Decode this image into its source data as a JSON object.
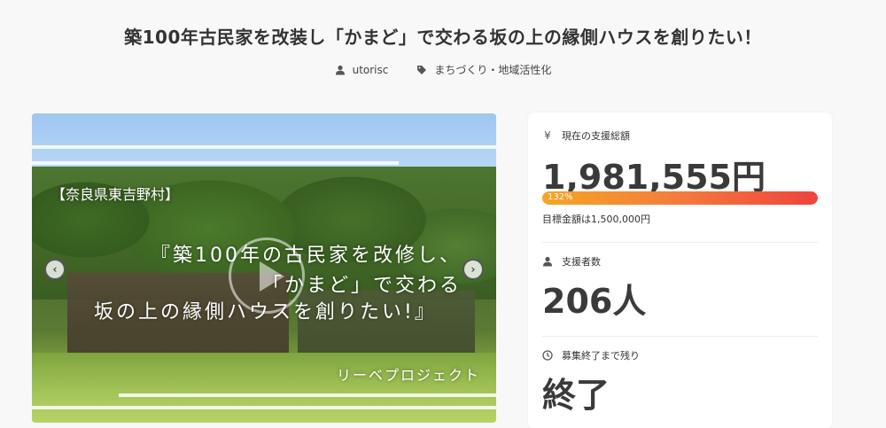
{
  "title": "築100年古民家を改装し「かまど」で交わる坂の上の縁側ハウスを創りたい！",
  "meta": {
    "author": "utorisc",
    "category": "まちづくり・地域活性化"
  },
  "hero": {
    "region": "【奈良県東吉野村】",
    "line1": "『築100年の古民家を改修し、",
    "line2": "「かまど」で交わる",
    "line3": "坂の上の縁側ハウスを創りたい!』",
    "project": "リーベプロジェクト",
    "prev_symbol": "‹",
    "next_symbol": "›"
  },
  "stats": {
    "funding_label": "現在の支援総額",
    "funding_amount": "1,981,555円",
    "progress_label": "132%",
    "progress_fraction": 1.0,
    "goal": "目標金額は1,500,000円",
    "supporters_label": "支援者数",
    "supporters_value": "206人",
    "remaining_label": "募集終了まで残り",
    "remaining_value": "終了"
  },
  "icons": {
    "author": "user-icon",
    "category": "tag-icon",
    "funding": "yen-icon",
    "supporters": "user-icon",
    "remaining": "clock-icon"
  },
  "colors": {
    "progress_start": "#f5a623",
    "progress_end": "#f0423c"
  }
}
